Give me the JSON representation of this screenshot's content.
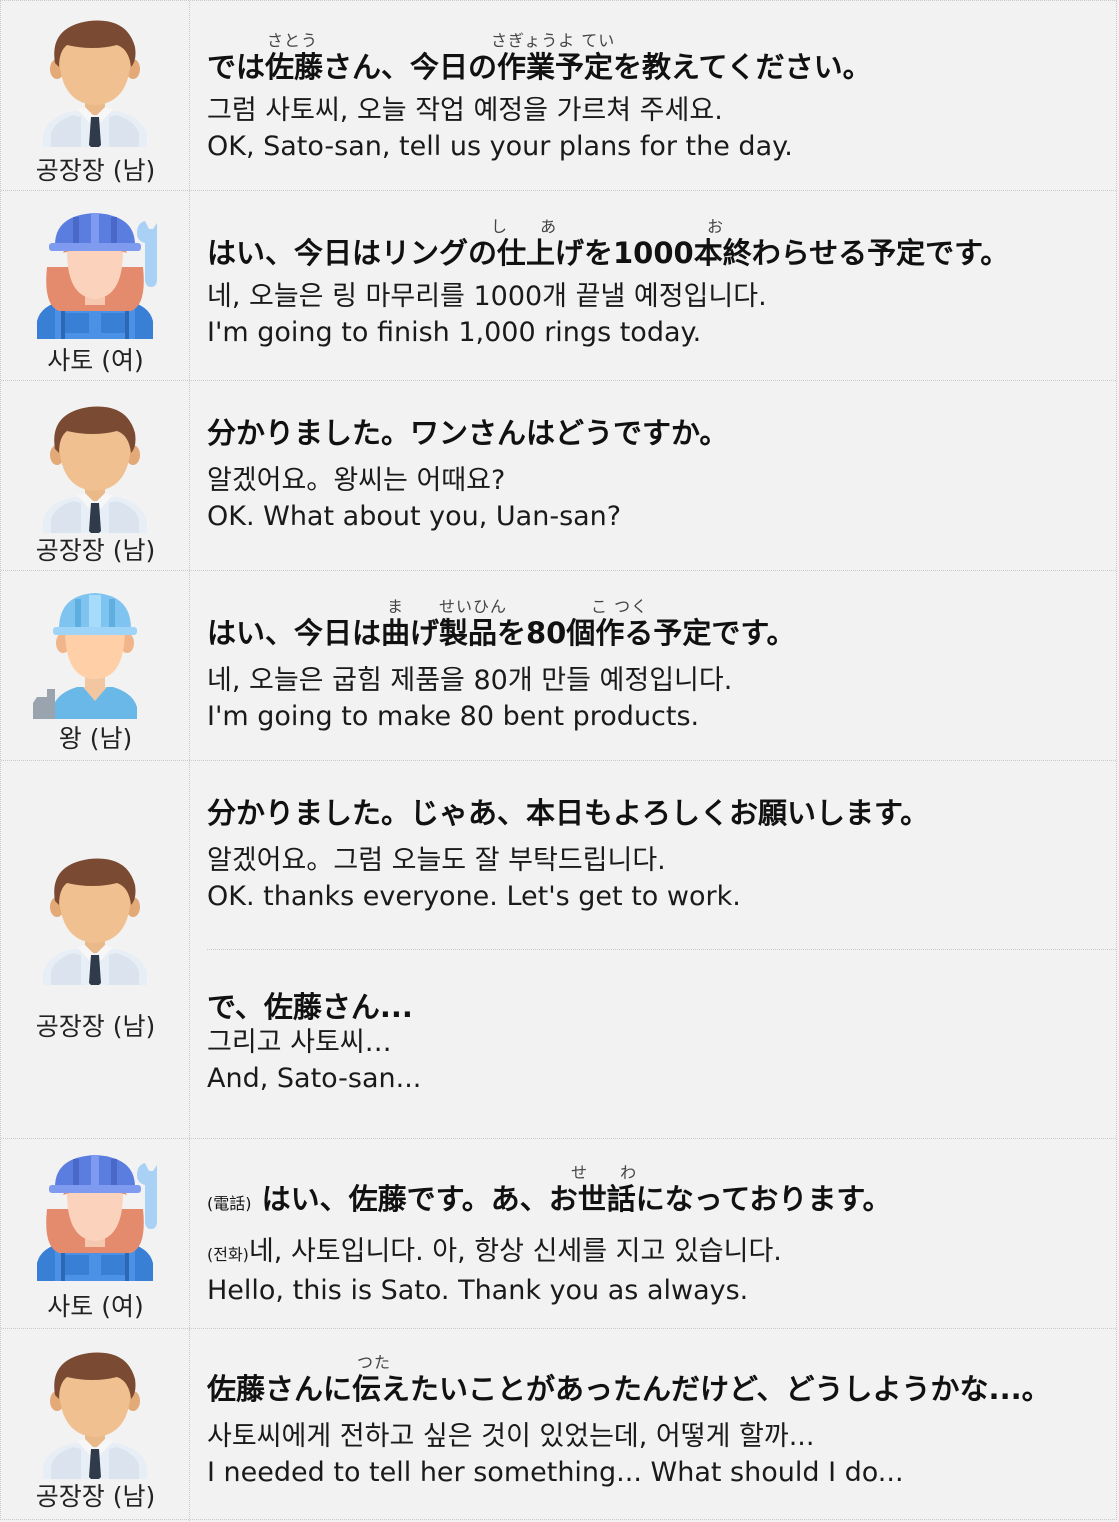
{
  "rows": [
    {
      "speaker": "공장장 (남)",
      "avatar": "manager-avatar",
      "ruby": [
        "さとう",
        "さぎょうよ てい"
      ],
      "jp": "では佐藤さん、今日の作業予定を教えてください。",
      "ko": "그럼 사토씨, 오늘 작업 예정을 가르쳐 주세요.",
      "en": "OK, Sato-san, tell us your plans for the day."
    },
    {
      "speaker": "사토 (여)",
      "avatar": "female-worker-avatar",
      "ruby": [
        "し あ",
        "お"
      ],
      "jp": "はい、今日はリングの仕上げを1000本終わらせる予定です。",
      "ko": "네, 오늘은 링 마무리를 1000개 끝낼 예정입니다.",
      "en": "I'm going to finish 1,000 rings today."
    },
    {
      "speaker": "공장장 (남)",
      "avatar": "manager-avatar",
      "jp": "分かりました。ワンさんはどうですか。",
      "ko": "알겠어요。왕씨는 어때요?",
      "en": "OK. What about you, Uan-san?"
    },
    {
      "speaker": "왕 (남)",
      "avatar": "male-worker-avatar",
      "ruby": [
        "ま",
        "せいひん",
        "こ つく"
      ],
      "jp": "はい、今日は曲げ製品を80個作る予定です。",
      "ko": "네, 오늘은 굽힘 제품을 80개 만들 예정입니다.",
      "en": "I'm going to make 80 bent products."
    },
    {
      "speaker": "공장장 (남)",
      "avatar": "manager-avatar",
      "jp": "分かりました。じゃあ、本日もよろしくお願いします。",
      "ko": "알겠어요。그럼 오늘도 잘 부탁드립니다.",
      "en": "OK. thanks everyone. Let's get to work.",
      "jp2": "で、佐藤さん...",
      "ko2": "그리고 사토씨…",
      "en2": "And, Sato-san..."
    },
    {
      "speaker": "사토 (여)",
      "avatar": "female-worker-avatar",
      "ruby": [
        "せ わ"
      ],
      "jp_tag": "(電話)",
      "jp": "はい、佐藤です。あ、お世話になっております。",
      "ko_tag": "(전화)",
      "ko": "네, 사토입니다. 아, 항상 신세를 지고 있습니다.",
      "en": "Hello, this is Sato. Thank you as always."
    },
    {
      "speaker": "공장장 (남)",
      "avatar": "manager-avatar",
      "ruby": [
        "つた"
      ],
      "jp": "佐藤さんに伝えたいことがあったんだけど、どうしようかな...。",
      "ko": "사토씨에게 전하고 싶은 것이 있었는데, 어떻게 할까...",
      "en": "I needed to tell her something... What should I do..."
    }
  ]
}
